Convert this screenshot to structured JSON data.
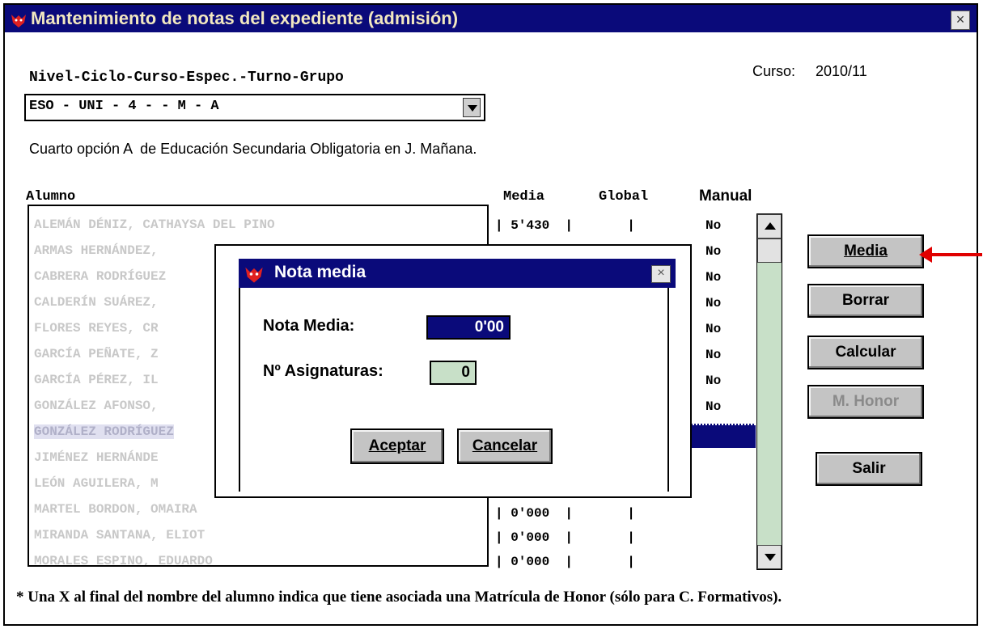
{
  "window": {
    "title": "Mantenimiento de notas del expediente (admisión)",
    "close": "×"
  },
  "course": {
    "label": "Curso:",
    "value": "2010/11"
  },
  "group_selector": {
    "label": "Nivel-Ciclo-Curso-Espec.-Turno-Grupo",
    "value": "ESO - UNI -  4  -        -  M  -  A"
  },
  "group_description": "Cuarto opción A  de Educación Secundaria Obligatoria en J. Mañana.",
  "columns": {
    "alumno": "Alumno",
    "media": "Media",
    "global": "Global",
    "manual": "Manual"
  },
  "students": [
    "ALEMÁN DÉNIZ, CATHAYSA DEL PINO",
    "ARMAS HERNÁNDEZ,",
    "CABRERA RODRÍGUEZ",
    "CALDERÍN SUÁREZ,",
    "FLORES REYES, CR",
    "GARCÍA PEÑATE, Z",
    "GARCÍA PÉREZ, IL",
    "GONZÁLEZ AFONSO,",
    "GONZÁLEZ RODRÍGUEZ",
    "JIMÉNEZ HERNÁNDE",
    "LEÓN AGUILERA, M",
    "MARTEL BORDON, OMAIRA",
    "MIRANDA SANTANA, ELIOT",
    "MORALES ESPINO, EDUARDO"
  ],
  "grades": {
    "row1": "| 5'430  |       |",
    "row12": "| 0'000  |       |",
    "row13": "| 0'000  |       |",
    "row14": "| 0'000  |       |"
  },
  "manual_values": [
    "No",
    "No",
    "No",
    "No",
    "No",
    "No",
    "No",
    "No"
  ],
  "buttons": {
    "media": "Media",
    "borrar": "Borrar",
    "calcular": "Calcular",
    "m_honor": "M. Honor",
    "salir": "Salir"
  },
  "dialog": {
    "title": "Nota media",
    "close": "×",
    "nota_media_label": "Nota Media:",
    "nota_media_value": "0'00",
    "asignaturas_label": "Nº Asignaturas:",
    "asignaturas_value": "0",
    "aceptar": "Aceptar",
    "cancelar": "Cancelar"
  },
  "footer_note": "* Una X al final del nombre del alumno indica que tiene asociada una Matrícula de Honor (sólo  para C. Formativos).",
  "colors": {
    "titlebar": "#0a0a7a",
    "field_blue": "#0a0a7a",
    "field_green": "#c8e0c8",
    "arrow": "#e00000"
  }
}
